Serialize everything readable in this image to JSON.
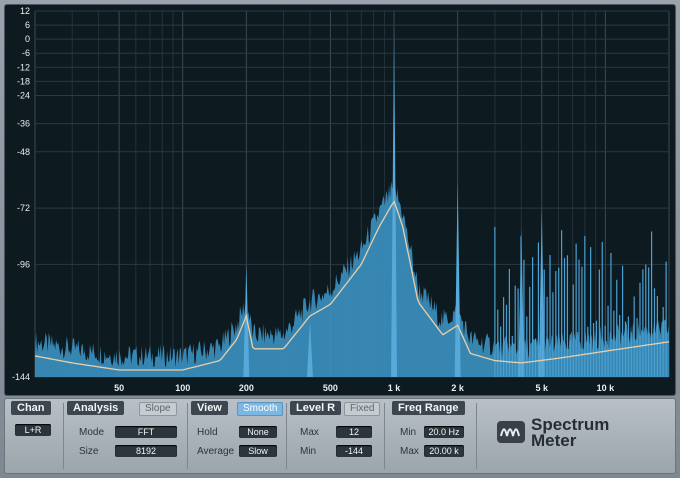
{
  "display": {
    "y_ticks": [
      "12",
      "6",
      "0",
      "-6",
      "-12",
      "-18",
      "-24",
      "-36",
      "-48",
      "-72",
      "-96",
      "-144"
    ],
    "x_ticks": [
      "50",
      "100",
      "200",
      "500",
      "1 k",
      "2 k",
      "5 k",
      "10 k"
    ]
  },
  "chart_data": {
    "type": "area",
    "x_scale": "log",
    "x_unit": "Hz",
    "y_unit": "dB",
    "xlim": [
      20,
      20000
    ],
    "ylim": [
      -144,
      12
    ],
    "fill_color": "#3b8fbe",
    "curve_color": "#e8cfa8",
    "background_color": "#0d1a20",
    "peaks": [
      {
        "x": 200,
        "y": -96
      },
      {
        "x": 400,
        "y": -120
      },
      {
        "x": 1000,
        "y": 4
      },
      {
        "x": 2000,
        "y": -60
      },
      {
        "x": 4000,
        "y": -80
      },
      {
        "x": 5000,
        "y": -72
      }
    ],
    "smooth_curve": [
      {
        "x": 20,
        "y": -135
      },
      {
        "x": 30,
        "y": -138
      },
      {
        "x": 50,
        "y": -141
      },
      {
        "x": 100,
        "y": -141
      },
      {
        "x": 150,
        "y": -137
      },
      {
        "x": 180,
        "y": -128
      },
      {
        "x": 200,
        "y": -118
      },
      {
        "x": 215,
        "y": -132
      },
      {
        "x": 300,
        "y": -132
      },
      {
        "x": 400,
        "y": -118
      },
      {
        "x": 500,
        "y": -113
      },
      {
        "x": 700,
        "y": -96
      },
      {
        "x": 850,
        "y": -80
      },
      {
        "x": 1000,
        "y": -69
      },
      {
        "x": 1100,
        "y": -80
      },
      {
        "x": 1300,
        "y": -112
      },
      {
        "x": 1700,
        "y": -126
      },
      {
        "x": 2000,
        "y": -122
      },
      {
        "x": 2300,
        "y": -134
      },
      {
        "x": 3000,
        "y": -137
      },
      {
        "x": 4000,
        "y": -138
      },
      {
        "x": 6000,
        "y": -136
      },
      {
        "x": 10000,
        "y": -133
      },
      {
        "x": 20000,
        "y": -129
      }
    ]
  },
  "controls": {
    "chan": {
      "header": "Chan",
      "value": "L+R"
    },
    "analysis": {
      "header": "Analysis",
      "slope_label": "Slope",
      "mode_label": "Mode",
      "mode_value": "FFT",
      "size_label": "Size",
      "size_value": "8192"
    },
    "view": {
      "header": "View",
      "smooth_label": "Smooth",
      "hold_label": "Hold",
      "hold_value": "None",
      "average_label": "Average",
      "average_value": "Slow"
    },
    "level_r": {
      "header": "Level R",
      "fixed_label": "Fixed",
      "max_label": "Max",
      "max_value": "12",
      "min_label": "Min",
      "min_value": "-144"
    },
    "freq_range": {
      "header": "Freq Range",
      "min_label": "Min",
      "min_value": "20.0 Hz",
      "max_label": "Max",
      "max_value": "20.00 k"
    },
    "logo": {
      "line1": "Spectrum",
      "line2": "Meter"
    }
  }
}
